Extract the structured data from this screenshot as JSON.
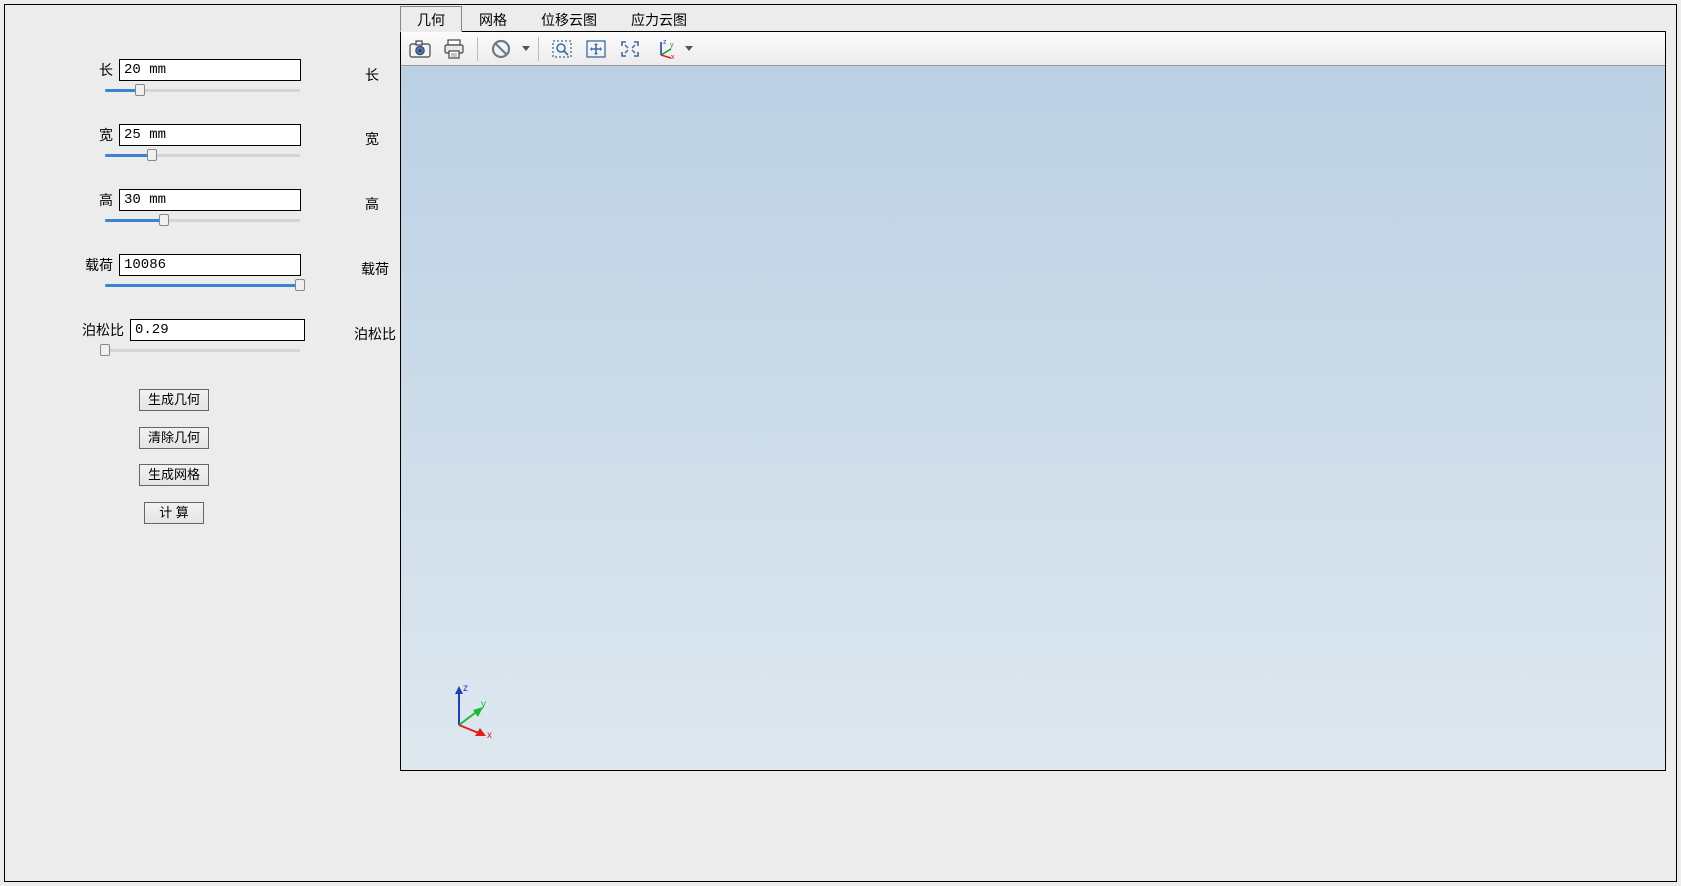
{
  "params": {
    "length": {
      "label": "长",
      "value": "20 mm",
      "slider_pct": 18
    },
    "width": {
      "label": "宽",
      "value": "25 mm",
      "slider_pct": 24
    },
    "height": {
      "label": "高",
      "value": "30 mm",
      "slider_pct": 30
    },
    "load": {
      "label": "载荷",
      "value": "10086",
      "slider_pct": 100
    },
    "poisson": {
      "label": "泊松比",
      "value": "0.29",
      "slider_pct": 0
    }
  },
  "mirror_labels": {
    "length": "长",
    "width": "宽",
    "height": "高",
    "load": "载荷",
    "poisson": "泊松比"
  },
  "buttons": {
    "gen_geom": "生成几何",
    "clear_geom": "清除几何",
    "gen_mesh": "生成网格",
    "compute": "计 算"
  },
  "tabs": {
    "active_index": 0,
    "items": [
      "几何",
      "网格",
      "位移云图",
      "应力云图"
    ]
  },
  "toolbar": {
    "camera": "camera-icon",
    "print": "print-icon",
    "nosign": "no-sign-icon",
    "zoombox": "zoom-box-icon",
    "pan": "pan-icon",
    "fit": "fit-view-icon",
    "axes": "axes-orient-icon"
  },
  "axes": {
    "x": "x",
    "y": "y",
    "z": "z"
  }
}
